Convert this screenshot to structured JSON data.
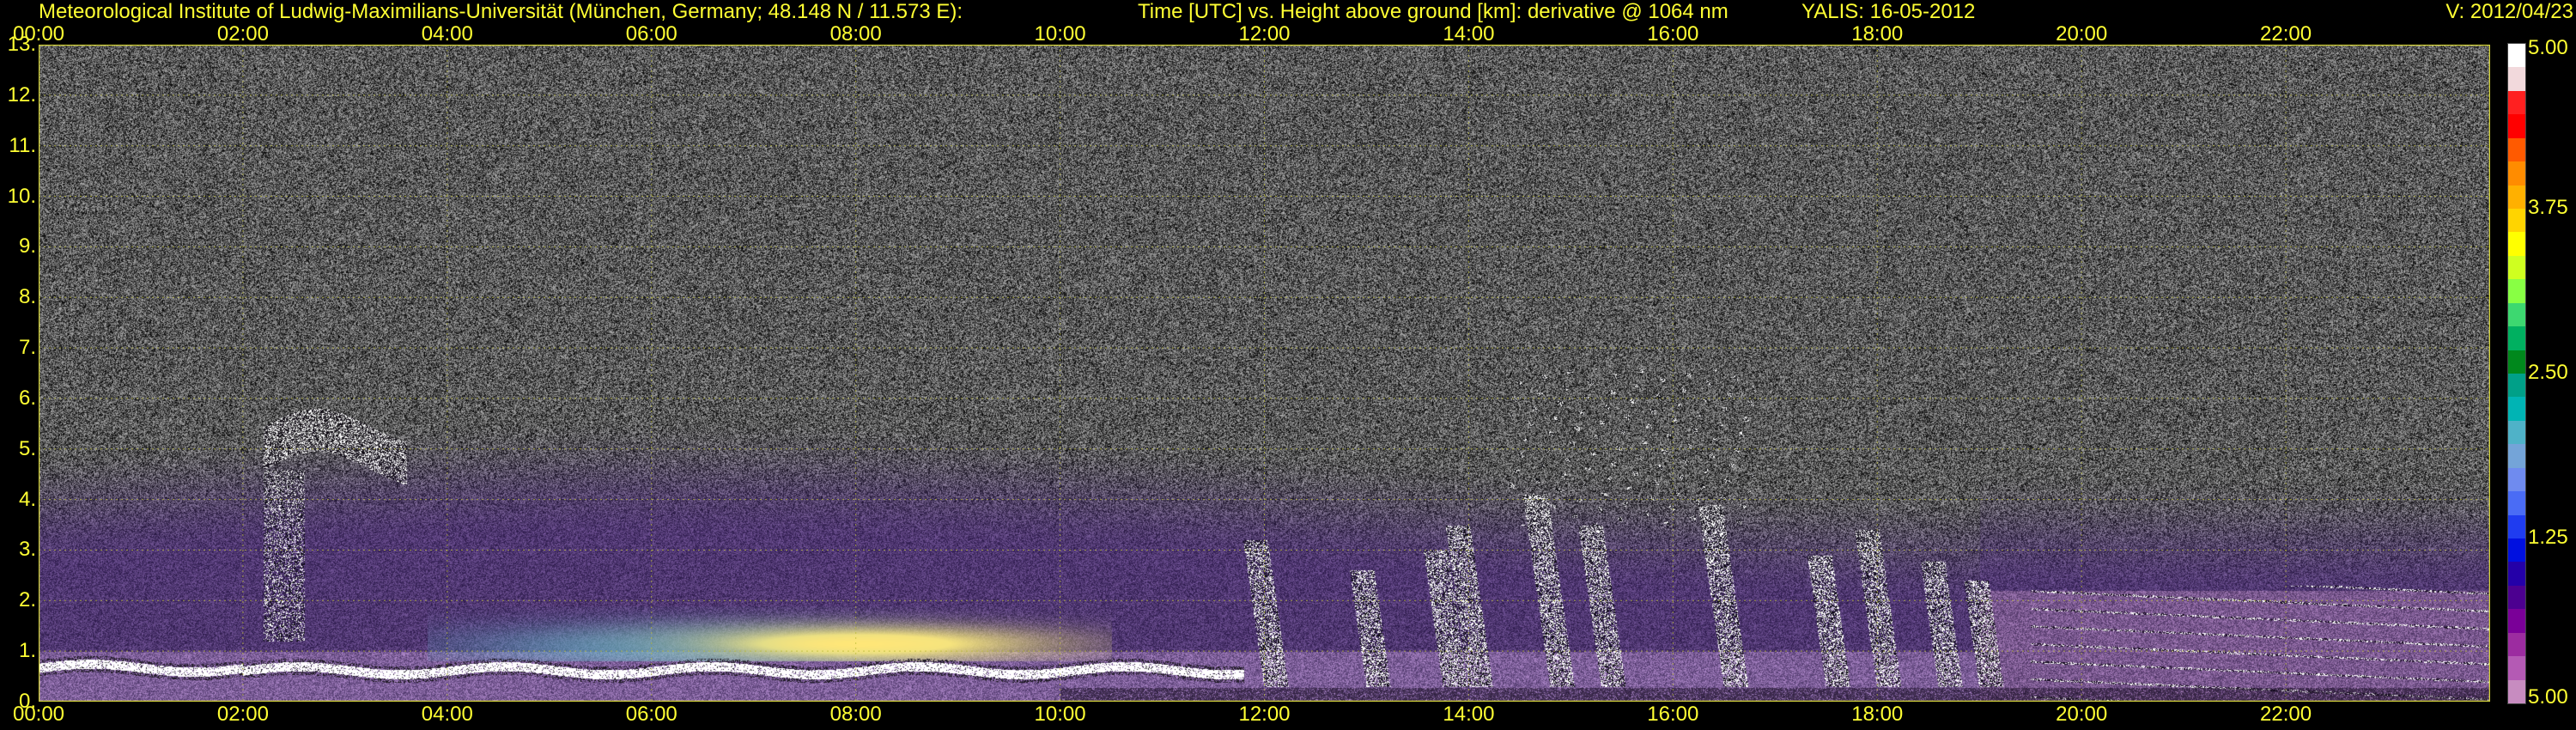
{
  "header": {
    "institute": "Meteorological Institute of Ludwig-Maximilians-Universität (München, Germany; 48.148 N / 11.573 E):",
    "description": "Time [UTC] vs. Height above ground [km]: derivative @ 1064 nm",
    "instrument": "YALIS: 16-05-2012",
    "version": "V: 2012/04/23"
  },
  "chart_data": {
    "type": "heatmap",
    "title": "Time [UTC] vs. Height above ground [km]: derivative @ 1064 nm",
    "xlabel": "Time [UTC]",
    "ylabel": "Height above ground [km]",
    "x_ticks": [
      "00:00",
      "02:00",
      "04:00",
      "06:00",
      "08:00",
      "10:00",
      "12:00",
      "14:00",
      "16:00",
      "18:00",
      "20:00",
      "22:00"
    ],
    "x_range_hours": [
      0,
      24
    ],
    "y_ticks": [
      "13.",
      "12.",
      "11.",
      "10.",
      "9.",
      "8.",
      "7.",
      "6.",
      "5.",
      "4.",
      "3.",
      "2.",
      "1.",
      "0."
    ],
    "y_range_km": [
      0,
      13
    ],
    "colorbar": {
      "ticks": [
        "5.00",
        "3.75",
        "2.50",
        "1.25",
        "5.00"
      ],
      "colors_top_to_bottom": [
        "#ffffff",
        "#f2d9dc",
        "#ff2020",
        "#ff0000",
        "#ff5a00",
        "#ff8c00",
        "#ffb000",
        "#ffd400",
        "#ffff00",
        "#cfff20",
        "#88ff44",
        "#3dd870",
        "#00b060",
        "#00881c",
        "#00a088",
        "#00b4b4",
        "#4fb2c8",
        "#74a4d8",
        "#6f8bef",
        "#4a6cf5",
        "#1f3cf0",
        "#0010e0",
        "#2400a8",
        "#4c0090",
        "#7a0098",
        "#9c2ca0",
        "#b45ab4",
        "#c78cc0"
      ]
    },
    "features": [
      {
        "name": "nocturnal boundary layer top",
        "t_start": 0.0,
        "t_end": 11.8,
        "height_km": 0.7
      },
      {
        "name": "elevated aerosol / cloud layer",
        "t_start": 2.2,
        "t_end": 3.6,
        "height_km_top": 5.5,
        "height_km_bottom": 4.6
      },
      {
        "name": "convective plumes",
        "t_start": 12.0,
        "t_end": 19.5,
        "height_km_max": 6.6
      },
      {
        "name": "residual layers",
        "t_start": 19.5,
        "t_end": 24.0,
        "height_km_max": 2.2
      }
    ],
    "grid": true
  }
}
